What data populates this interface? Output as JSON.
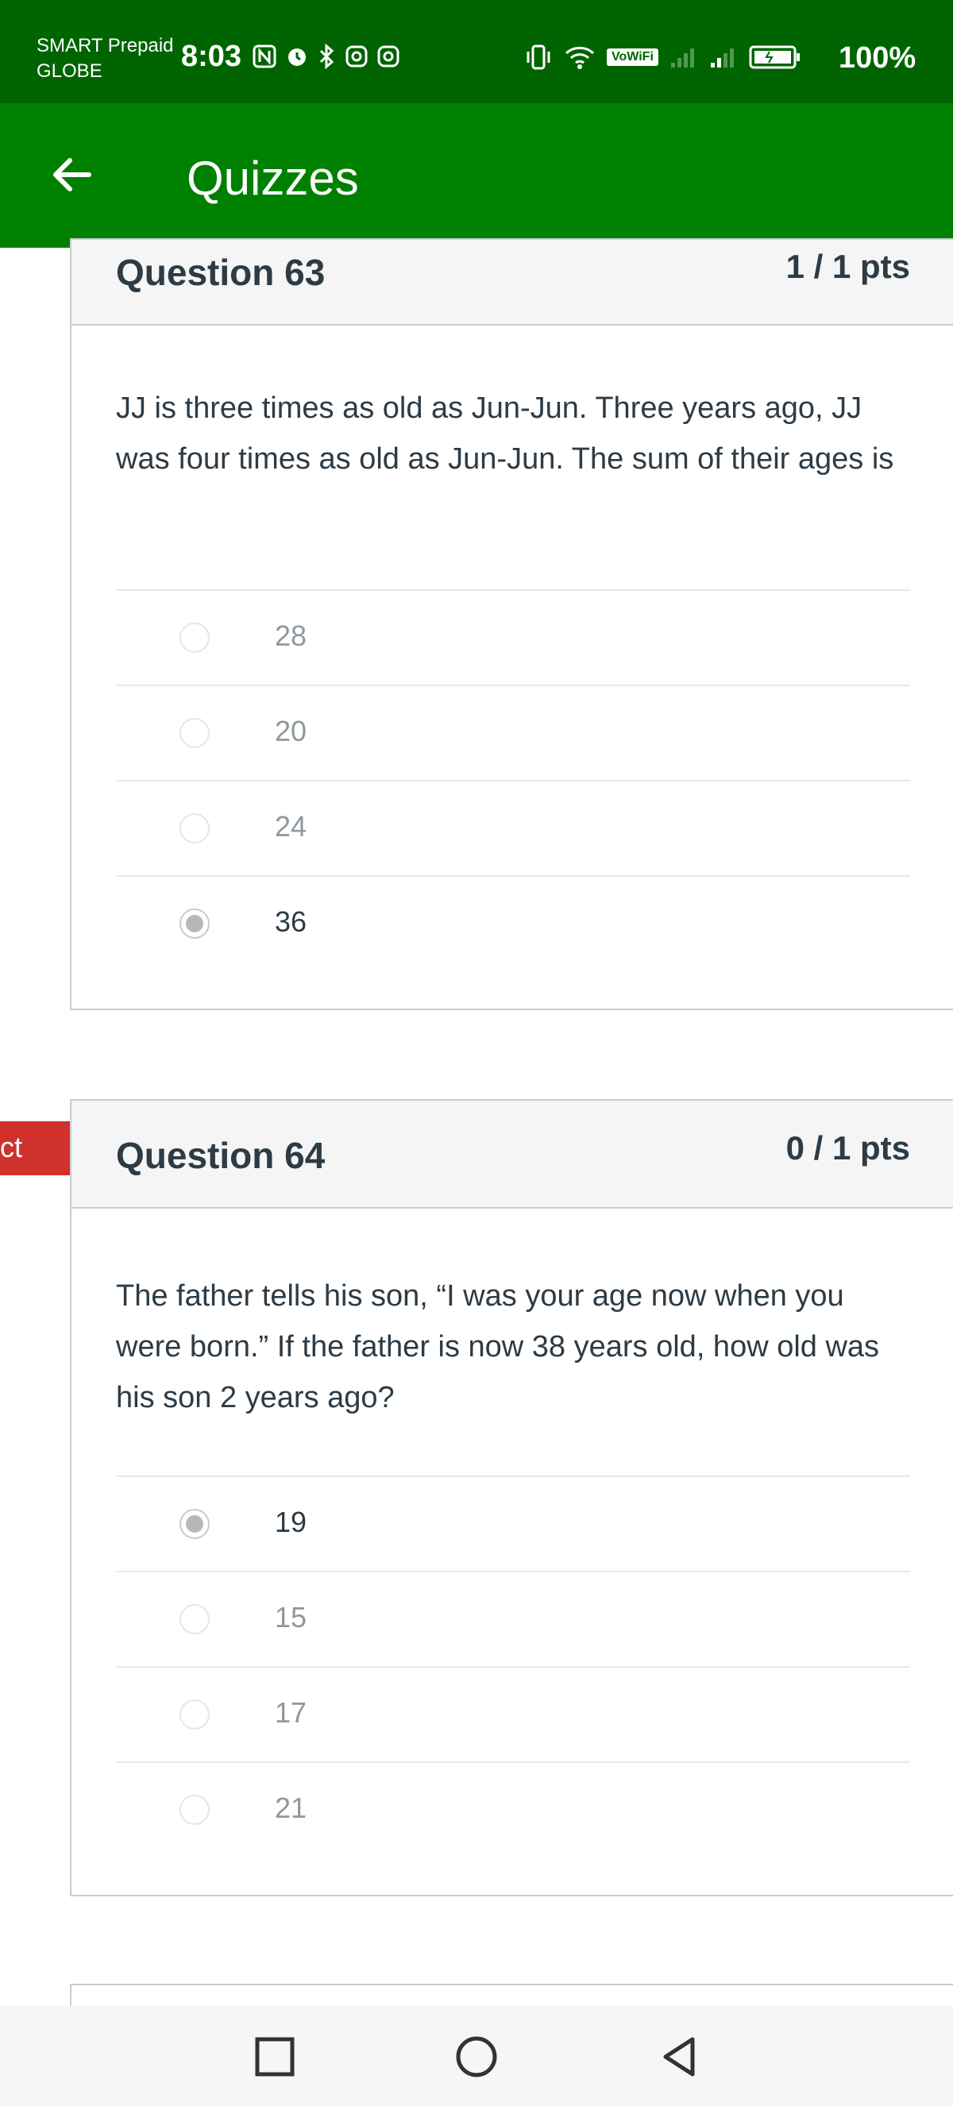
{
  "status_bar": {
    "carrier_line1": "SMART Prepaid",
    "carrier_line2": "GLOBE",
    "time": "8:03",
    "battery": "100%",
    "left_icons": [
      "nfc-icon",
      "alarm-icon",
      "bluetooth-icon",
      "instagram-icon",
      "instagram-icon"
    ],
    "right_icons": [
      "vibrate-icon",
      "wifi-icon",
      "vowifi-icon",
      "signal-icon",
      "signal-icon",
      "battery-icon"
    ],
    "vowifi_label": "VoWiFi"
  },
  "app_bar": {
    "title": "Quizzes"
  },
  "questions": [
    {
      "title": "Question 63",
      "points": "1 / 1 pts",
      "text": "JJ is three times as old as Jun-Jun. Three years ago, JJ was four times as old as Jun-Jun. The sum of their ages is",
      "answers": [
        {
          "label": "28",
          "selected": false
        },
        {
          "label": "20",
          "selected": false
        },
        {
          "label": "24",
          "selected": false
        },
        {
          "label": "36",
          "selected": true
        }
      ]
    },
    {
      "title": "Question 64",
      "points": "0 / 1 pts",
      "flag": "ct",
      "text": "The father tells his son, “I was your age now when you were born.” If the father is now 38 years old, how old was his son 2 years ago?",
      "answers": [
        {
          "label": "19",
          "selected": true
        },
        {
          "label": "15",
          "selected": false
        },
        {
          "label": "17",
          "selected": false
        },
        {
          "label": "21",
          "selected": false
        }
      ]
    }
  ],
  "colors": {
    "status_bar": "#006400",
    "app_bar": "#008000",
    "incorrect_flag": "#d0312d"
  }
}
